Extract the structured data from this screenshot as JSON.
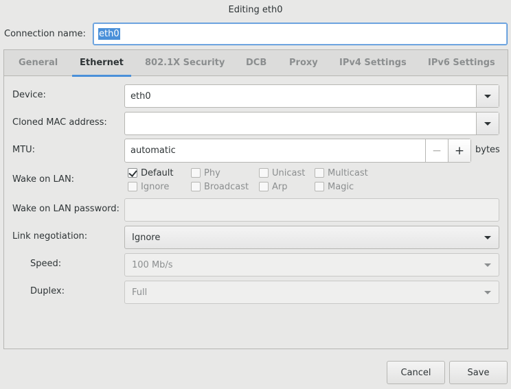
{
  "window": {
    "title": "Editing eth0"
  },
  "connection": {
    "label": "Connection name:",
    "value": "eth0"
  },
  "tabs": [
    {
      "label": "General"
    },
    {
      "label": "Ethernet"
    },
    {
      "label": "802.1X Security"
    },
    {
      "label": "DCB"
    },
    {
      "label": "Proxy"
    },
    {
      "label": "IPv4 Settings"
    },
    {
      "label": "IPv6 Settings"
    }
  ],
  "active_tab": "Ethernet",
  "ethernet": {
    "device": {
      "label": "Device:",
      "value": "eth0"
    },
    "cloned_mac": {
      "label": "Cloned MAC address:",
      "value": ""
    },
    "mtu": {
      "label": "MTU:",
      "value": "automatic",
      "unit": "bytes",
      "minus": "−",
      "plus": "+"
    },
    "wake_on_lan": {
      "label": "Wake on LAN:",
      "options": [
        {
          "label": "Default",
          "checked": true
        },
        {
          "label": "Phy",
          "checked": false
        },
        {
          "label": "Unicast",
          "checked": false
        },
        {
          "label": "Multicast",
          "checked": false
        },
        {
          "label": "Ignore",
          "checked": false
        },
        {
          "label": "Broadcast",
          "checked": false
        },
        {
          "label": "Arp",
          "checked": false
        },
        {
          "label": "Magic",
          "checked": false
        }
      ]
    },
    "wol_password": {
      "label": "Wake on LAN password:",
      "value": ""
    },
    "link_negotiation": {
      "label": "Link negotiation:",
      "value": "Ignore"
    },
    "speed": {
      "label": "Speed:",
      "value": "100 Mb/s"
    },
    "duplex": {
      "label": "Duplex:",
      "value": "Full"
    }
  },
  "buttons": {
    "cancel": "Cancel",
    "save": "Save"
  },
  "colors": {
    "accent": "#4a90d9",
    "background": "#e8e8e7",
    "text": "#2e3436",
    "dim_text": "#8b8e8f"
  }
}
